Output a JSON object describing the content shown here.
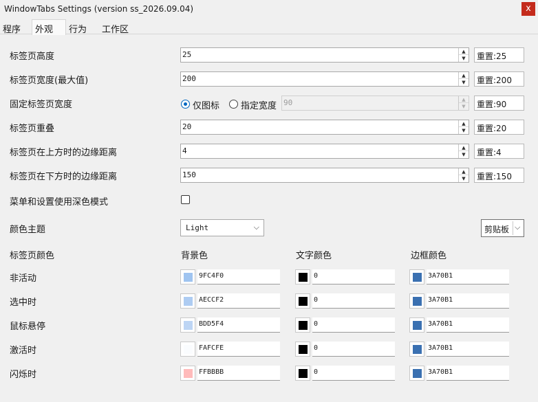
{
  "window": {
    "title": "WindowTabs Settings (version ss_2026.09.04)",
    "close_label": "x"
  },
  "tabs": [
    {
      "label": "程序"
    },
    {
      "label": "外观"
    },
    {
      "label": "行为"
    },
    {
      "label": "工作区"
    }
  ],
  "active_tab": "外观",
  "settings": {
    "tab_height": {
      "label": "标签页高度",
      "value": "25",
      "reset": "重置:25"
    },
    "tab_max_width": {
      "label": "标签页宽度(最大值)",
      "value": "200",
      "reset": "重置:200"
    },
    "fixed_width": {
      "label": "固定标签页宽度",
      "option_icon": "仅图标",
      "option_width": "指定宽度",
      "selected": "仅图标",
      "value": "90",
      "reset": "重置:90"
    },
    "tab_overlap": {
      "label": "标签页重叠",
      "value": "20",
      "reset": "重置:20"
    },
    "margin_top": {
      "label": "标签页在上方时的边缘距离",
      "value": "4",
      "reset": "重置:4"
    },
    "margin_bottom": {
      "label": "标签页在下方时的边缘距离",
      "value": "150",
      "reset": "重置:150"
    },
    "dark_menu": {
      "label": "菜单和设置使用深色模式",
      "checked": false
    },
    "theme": {
      "label": "颜色主题",
      "value": "Light"
    },
    "clipboard_label": "剪贴板"
  },
  "colors": {
    "section_label": "标签页颜色",
    "headers": {
      "bg": "背景色",
      "text": "文字颜色",
      "border": "边框颜色"
    },
    "rows": [
      {
        "label": "非活动",
        "bg": "9FC4F0",
        "text": "0",
        "border": "3A70B1",
        "bg_hex": "#9FC4F0",
        "text_hex": "#000000",
        "border_hex": "#3A70B1"
      },
      {
        "label": "选中时",
        "bg": "AECCF2",
        "text": "0",
        "border": "3A70B1",
        "bg_hex": "#AECCF2",
        "text_hex": "#000000",
        "border_hex": "#3A70B1"
      },
      {
        "label": "鼠标悬停",
        "bg": "BDD5F4",
        "text": "0",
        "border": "3A70B1",
        "bg_hex": "#BDD5F4",
        "text_hex": "#000000",
        "border_hex": "#3A70B1"
      },
      {
        "label": "激活时",
        "bg": "FAFCFE",
        "text": "0",
        "border": "3A70B1",
        "bg_hex": "#FAFCFE",
        "text_hex": "#000000",
        "border_hex": "#3A70B1"
      },
      {
        "label": "闪烁时",
        "bg": "FFBBBB",
        "text": "0",
        "border": "3A70B1",
        "bg_hex": "#FFBBBB",
        "text_hex": "#000000",
        "border_hex": "#3A70B1"
      }
    ]
  }
}
